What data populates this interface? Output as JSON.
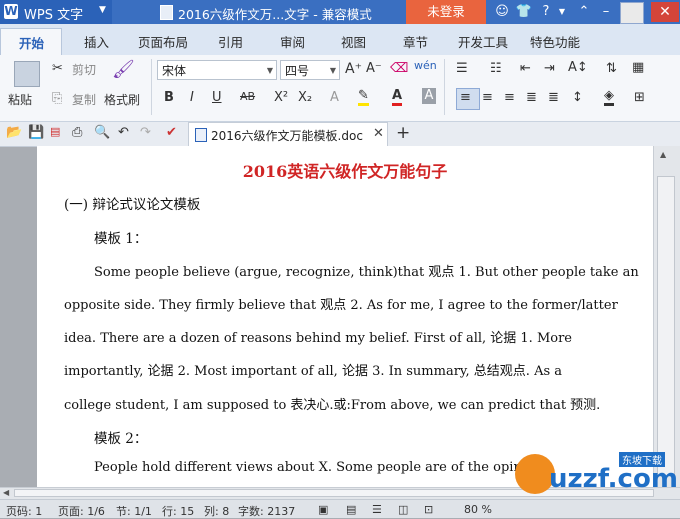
{
  "app": {
    "name": "WPS 文字",
    "window_title": "2016六级作文万...文字 - 兼容模式",
    "login": "未登录"
  },
  "tabs": [
    "开始",
    "插入",
    "页面布局",
    "引用",
    "审阅",
    "视图",
    "章节",
    "开发工具",
    "特色功能"
  ],
  "clipboard": {
    "paste": "粘贴",
    "cut": "剪切",
    "copy": "复制",
    "format_painter": "格式刷"
  },
  "font": {
    "family": "宋体",
    "size": "四号"
  },
  "doc_tab": {
    "name": "2016六级作文万能模板.doc"
  },
  "document": {
    "title": "2016英语六级作文万能句子",
    "section1": "(一) 辩论式议论文模板",
    "template1": "模板 1：",
    "lines": [
      "Some people believe (argue, recognize, think)that  观点 1. But other people take an",
      "opposite side. They firmly believe that  观点 2. As for me, I agree to the former/latter",
      "idea. There are a dozen of reasons behind my belief. First of all,  论据 1. More",
      "importantly,  论据 2. Most important of all,  论据 3. In summary,  总结观点. As a",
      "college student, I am supposed to  表决心.或:From above, we can predict that  预测."
    ],
    "template2": "模板 2：",
    "line_last": "People hold different views about X. Some people are of the opinion"
  },
  "status": {
    "page": "页码: 1",
    "pages": "页面: 1/6",
    "section": "节: 1/1",
    "row": "行: 15",
    "col": "列: 8",
    "words": "字数: 2137",
    "zoom": "80 %"
  },
  "watermark": {
    "text": "uzzf.com",
    "sub": "东坡下载"
  }
}
